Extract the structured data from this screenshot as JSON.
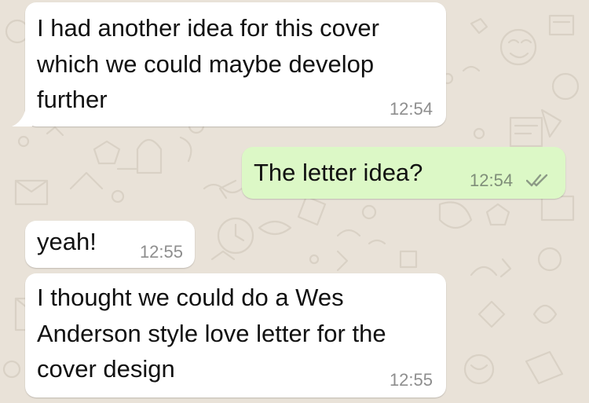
{
  "chat": {
    "colors": {
      "wallpaper": "#e9e2d8",
      "incoming_bubble": "#ffffff",
      "outgoing_bubble": "#dcf8c6",
      "read_tick": "#8c9a86"
    },
    "messages": [
      {
        "direction": "incoming",
        "text": "I had another idea for this cover\nwhich we could maybe develop\nfurther",
        "time": "12:54"
      },
      {
        "direction": "outgoing",
        "text": "The letter idea?",
        "time": "12:54",
        "status_icon": "double-check-icon"
      },
      {
        "direction": "incoming",
        "text": "yeah!",
        "time": "12:55"
      },
      {
        "direction": "incoming",
        "text": "I thought we could do a Wes\nAnderson style love letter for the\ncover design",
        "time": "12:55"
      }
    ]
  }
}
